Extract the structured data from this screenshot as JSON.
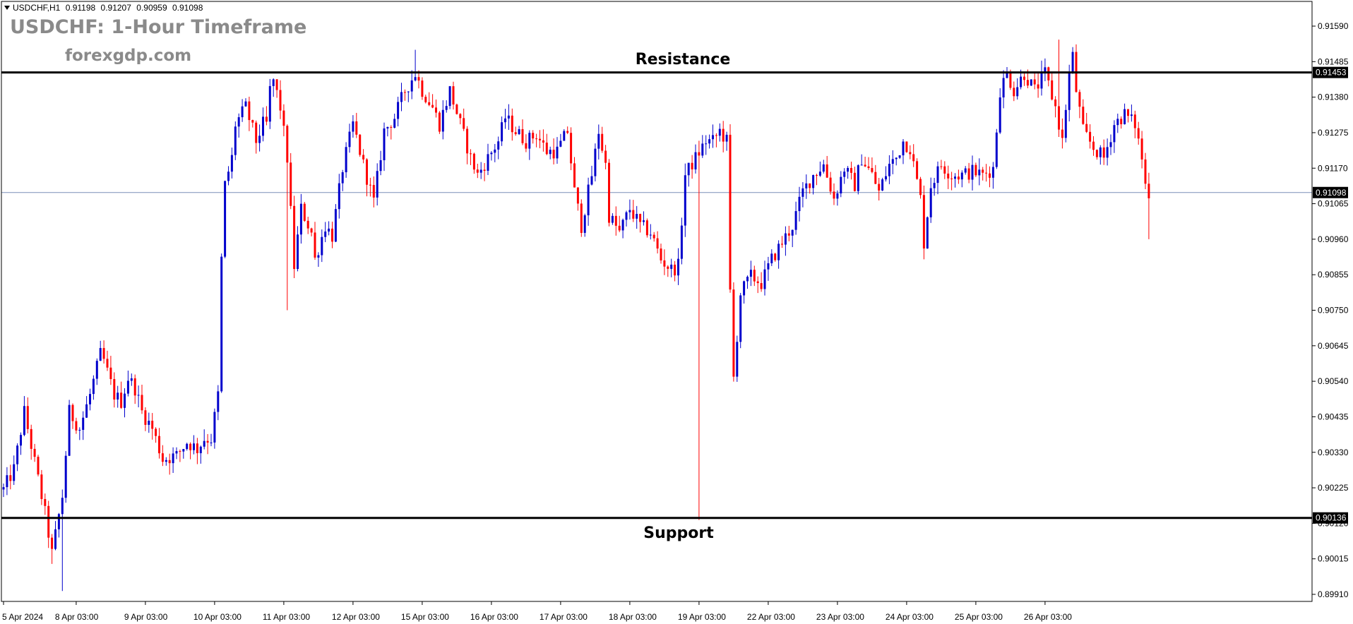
{
  "header": {
    "symbol": "USDCHF,H1",
    "ohlc": [
      "0.91198",
      "0.91207",
      "0.90959",
      "0.91098"
    ],
    "title": "USDCHF: 1-Hour Timeframe",
    "watermark": "forexgdp.com"
  },
  "levels": {
    "resistance_label": "Resistance",
    "support_label": "Support",
    "resistance_price": "0.91453",
    "support_price": "0.90136",
    "current_price": "0.91098"
  },
  "colors": {
    "bull": "#0000cc",
    "bear": "#ff0000",
    "level_line": "#000000",
    "current_line": "#7a8fb8",
    "axis": "#000000"
  },
  "chart_data": {
    "type": "candlestick",
    "y_ticks": [
      "0.91590",
      "0.91485",
      "0.91380",
      "0.91275",
      "0.91170",
      "0.91065",
      "0.90960",
      "0.90855",
      "0.90750",
      "0.90645",
      "0.90540",
      "0.90435",
      "0.90330",
      "0.90225",
      "0.90120",
      "0.90015",
      "0.89910"
    ],
    "ylim": [
      0.8988,
      0.9163
    ],
    "x_ticks": [
      "5 Apr 2024",
      "8 Apr 03:00",
      "9 Apr 03:00",
      "10 Apr 03:00",
      "11 Apr 03:00",
      "12 Apr 03:00",
      "15 Apr 03:00",
      "16 Apr 03:00",
      "17 Apr 03:00",
      "18 Apr 03:00",
      "19 Apr 03:00",
      "22 Apr 03:00",
      "23 Apr 03:00",
      "24 Apr 03:00",
      "25 Apr 03:00",
      "26 Apr 03:00"
    ],
    "x_tick_bar_index": [
      0,
      21,
      41,
      61,
      81,
      101,
      121,
      141,
      161,
      181,
      201,
      221,
      241,
      261,
      281,
      301
    ],
    "bar_count": 310,
    "anchors": [
      [
        0,
        0.9022
      ],
      [
        3,
        0.9028
      ],
      [
        6,
        0.9045
      ],
      [
        9,
        0.903
      ],
      [
        12,
        0.9015
      ],
      [
        14,
        0.9003
      ],
      [
        17,
        0.902
      ],
      [
        19,
        0.9045
      ],
      [
        22,
        0.904
      ],
      [
        25,
        0.905
      ],
      [
        28,
        0.9062
      ],
      [
        29,
        0.906
      ],
      [
        32,
        0.905
      ],
      [
        34,
        0.9048
      ],
      [
        36,
        0.9055
      ],
      [
        38,
        0.9052
      ],
      [
        40,
        0.9045
      ],
      [
        43,
        0.904
      ],
      [
        46,
        0.9031
      ],
      [
        50,
        0.9032
      ],
      [
        53,
        0.9036
      ],
      [
        56,
        0.9034
      ],
      [
        58,
        0.9037
      ],
      [
        60,
        0.9037
      ],
      [
        62,
        0.905
      ],
      [
        63,
        0.909
      ],
      [
        64,
        0.9112
      ],
      [
        66,
        0.912
      ],
      [
        67,
        0.913
      ],
      [
        70,
        0.9135
      ],
      [
        73,
        0.9125
      ],
      [
        75,
        0.913
      ],
      [
        76,
        0.913
      ],
      [
        77,
        0.914
      ],
      [
        78,
        0.9143
      ],
      [
        80,
        0.9135
      ],
      [
        82,
        0.912
      ],
      [
        84,
        0.9088
      ],
      [
        86,
        0.9105
      ],
      [
        89,
        0.9098
      ],
      [
        90,
        0.909
      ],
      [
        93,
        0.91
      ],
      [
        95,
        0.9097
      ],
      [
        98,
        0.9117
      ],
      [
        101,
        0.913
      ],
      [
        104,
        0.9118
      ],
      [
        107,
        0.9107
      ],
      [
        110,
        0.9128
      ],
      [
        113,
        0.9132
      ],
      [
        116,
        0.914
      ],
      [
        119,
        0.9145
      ],
      [
        121,
        0.914
      ],
      [
        124,
        0.9135
      ],
      [
        126,
        0.913
      ],
      [
        129,
        0.914
      ],
      [
        132,
        0.913
      ],
      [
        135,
        0.912
      ],
      [
        137,
        0.9115
      ],
      [
        140,
        0.912
      ],
      [
        143,
        0.9125
      ],
      [
        145,
        0.9132
      ],
      [
        148,
        0.9128
      ],
      [
        151,
        0.9125
      ],
      [
        154,
        0.9127
      ],
      [
        157,
        0.9122
      ],
      [
        160,
        0.9122
      ],
      [
        163,
        0.9128
      ],
      [
        165,
        0.911
      ],
      [
        167,
        0.91
      ],
      [
        170,
        0.9115
      ],
      [
        172,
        0.9128
      ],
      [
        174,
        0.9118
      ],
      [
        175,
        0.9103
      ],
      [
        178,
        0.9098
      ],
      [
        181,
        0.9105
      ],
      [
        184,
        0.91
      ],
      [
        187,
        0.9098
      ],
      [
        190,
        0.909
      ],
      [
        193,
        0.9087
      ],
      [
        195,
        0.9088
      ],
      [
        197,
        0.9115
      ],
      [
        200,
        0.912
      ],
      [
        203,
        0.9125
      ],
      [
        205,
        0.9125
      ],
      [
        207,
        0.9128
      ],
      [
        209,
        0.9125
      ],
      [
        210,
        0.908
      ],
      [
        211,
        0.9055
      ],
      [
        213,
        0.908
      ],
      [
        216,
        0.9085
      ],
      [
        219,
        0.9083
      ],
      [
        222,
        0.909
      ],
      [
        225,
        0.9095
      ],
      [
        228,
        0.91
      ],
      [
        231,
        0.911
      ],
      [
        234,
        0.9115
      ],
      [
        237,
        0.9118
      ],
      [
        240,
        0.9108
      ],
      [
        243,
        0.9117
      ],
      [
        246,
        0.9112
      ],
      [
        248,
        0.912
      ],
      [
        251,
        0.9115
      ],
      [
        253,
        0.911
      ],
      [
        256,
        0.9118
      ],
      [
        258,
        0.912
      ],
      [
        260,
        0.9125
      ],
      [
        262,
        0.9123
      ],
      [
        265,
        0.9108
      ],
      [
        266,
        0.9095
      ],
      [
        268,
        0.9112
      ],
      [
        271,
        0.9118
      ],
      [
        274,
        0.9115
      ],
      [
        277,
        0.9115
      ],
      [
        280,
        0.9116
      ],
      [
        283,
        0.9115
      ],
      [
        286,
        0.9117
      ],
      [
        288,
        0.914
      ],
      [
        290,
        0.9145
      ],
      [
        292,
        0.914
      ],
      [
        295,
        0.9145
      ],
      [
        298,
        0.914
      ],
      [
        301,
        0.9145
      ],
      [
        304,
        0.9135
      ],
      [
        306,
        0.9125
      ],
      [
        308,
        0.9145
      ],
      [
        309,
        0.915
      ],
      [
        310,
        0.914
      ],
      [
        312,
        0.9128
      ],
      [
        315,
        0.9123
      ],
      [
        318,
        0.912
      ],
      [
        321,
        0.913
      ],
      [
        324,
        0.9133
      ],
      [
        327,
        0.913
      ],
      [
        329,
        0.912
      ],
      [
        330,
        0.9112
      ],
      [
        331,
        0.911
      ]
    ],
    "notable_wicks": [
      {
        "bar": 14,
        "low": 0.9
      },
      {
        "bar": 17,
        "low": 0.8992
      },
      {
        "bar": 82,
        "low": 0.9075
      },
      {
        "bar": 201,
        "low": 0.9013
      },
      {
        "bar": 210,
        "high": 0.913
      },
      {
        "bar": 119,
        "high": 0.9152
      },
      {
        "bar": 305,
        "high": 0.9155
      },
      {
        "bar": 331,
        "low": 0.9096
      }
    ]
  }
}
